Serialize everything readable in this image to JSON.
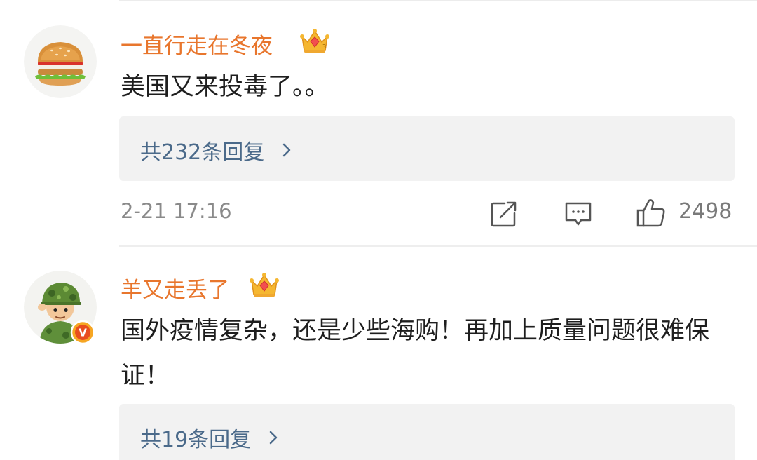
{
  "comments": [
    {
      "username": "一直行走在冬夜",
      "text": "美国又来投毒了。。",
      "reply_link": "共232条回复",
      "timestamp": "2-21 17:16",
      "likes": "2498",
      "avatar": "hamburger-avatar",
      "badge": "crown-icon"
    },
    {
      "username": "羊又走丢了",
      "text": "国外疫情复杂，还是少些海购！再加上质量问题很难保证！",
      "reply_link": "共19条回复",
      "avatar": "soldier-avatar",
      "badge": "crown-icon",
      "verified": "V"
    }
  ],
  "colors": {
    "username": "#e8762d",
    "reply_link": "#4b6a8a",
    "reply_box": "#f2f2f2",
    "meta": "#8a8a8a"
  }
}
